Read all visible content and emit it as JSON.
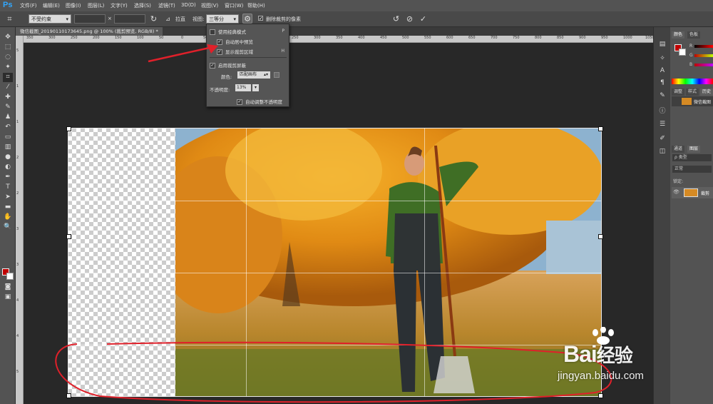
{
  "app": {
    "logo": "Ps"
  },
  "menu": [
    "文件(F)",
    "编辑(E)",
    "图像(I)",
    "图层(L)",
    "文字(Y)",
    "选择(S)",
    "滤镜(T)",
    "3D(D)",
    "视图(V)",
    "窗口(W)",
    "帮助(H)"
  ],
  "options": {
    "ratio": "不受约束",
    "x_sep": "×",
    "straighten": "拉直",
    "view_label": "视图:",
    "view_value": "三等分",
    "delete_cropped": "删除裁剪的像素"
  },
  "document": {
    "tab_title": "微信截图_20190110173645.png @ 100% (裁剪预览, RGB/8) *"
  },
  "crop_menu": {
    "classic": "使用经典模式",
    "classic_key": "P",
    "auto_center": "自动居中预览",
    "show_cropped": "显示裁剪区域",
    "show_cropped_key": "H",
    "enable_shield": "启用裁剪屏蔽",
    "color_label": "颜色:",
    "color_value": "匹配画布",
    "opacity_label": "不透明度:",
    "opacity_value": "13%",
    "auto_adjust": "自动调整不透明度"
  },
  "ruler": [
    "350",
    "300",
    "250",
    "200",
    "150",
    "100",
    "50",
    "0",
    "50",
    "100",
    "150",
    "200",
    "250",
    "300",
    "350",
    "400",
    "450",
    "500",
    "550",
    "600",
    "650",
    "700",
    "750",
    "800",
    "850",
    "900",
    "950",
    "1000",
    "1050"
  ],
  "panels": {
    "color_tab": "颜色",
    "swatch_tab": "色板",
    "r": "R",
    "g": "G",
    "b": "B",
    "adjust_tab": "调整",
    "style_tab": "样式",
    "history_tab": "历史",
    "history_item": "微信截图",
    "channel_tab": "通道",
    "layer_tab": "图层",
    "filter": "ρ 类型",
    "blend": "正常",
    "lock": "锁定:",
    "layer_name": "裁剪"
  },
  "colors": {
    "accent": "#31a8ff",
    "foreground": "#c00000",
    "annotation": "#e0202a"
  },
  "watermark": {
    "brand": "Bai",
    "brand2": "经验",
    "url": "jingyan.baidu.com"
  }
}
